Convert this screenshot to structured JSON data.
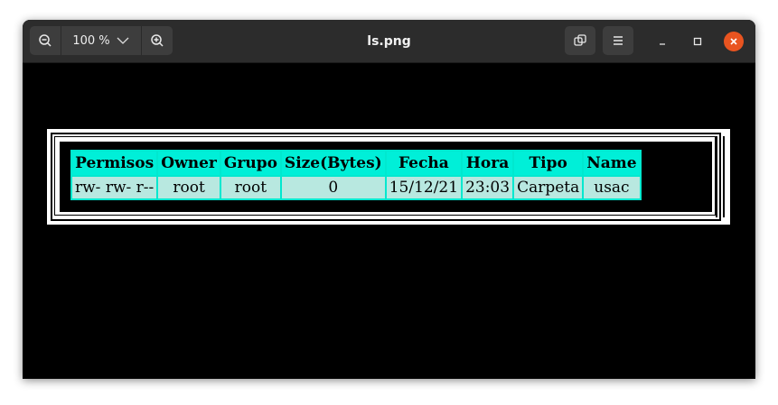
{
  "window": {
    "title": "ls.png",
    "zoom_value": "100 %"
  },
  "icons": {
    "zoom_out": "zoom-out-icon",
    "zoom_in": "zoom-in-icon",
    "chevron": "chevron-down-icon",
    "fit": "window-restore-icon",
    "menu": "hamburger-menu-icon",
    "minimize": "minimize-icon",
    "maximize": "maximize-icon",
    "close": "close-icon"
  },
  "colors": {
    "titlebar": "#2c2c2c",
    "close_button": "#e95420",
    "table_header": "#00efd8",
    "table_cell": "#b8e8e0"
  },
  "image_table": {
    "headers": [
      "Permisos",
      "Owner",
      "Grupo",
      "Size(Bytes)",
      "Fecha",
      "Hora",
      "Tipo",
      "Name"
    ],
    "rows": [
      [
        "rw- rw- r--",
        "root",
        "root",
        "0",
        "15/12/21",
        "23:03",
        "Carpeta",
        "usac"
      ]
    ]
  }
}
